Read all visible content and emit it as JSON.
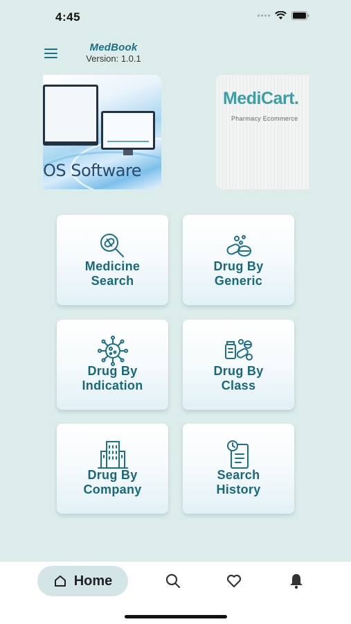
{
  "status_bar": {
    "time": "4:45"
  },
  "header": {
    "app_name": "MedBook",
    "version": "Version: 1.0.1"
  },
  "banners": [
    {
      "text": "OS Software"
    },
    {
      "title": "MediCart.",
      "subtitle": "Pharmacy Ecommerce"
    }
  ],
  "tiles": [
    {
      "label_1": "Medicine",
      "label_2": "Search",
      "icon": "medicine-search-icon"
    },
    {
      "label_1": "Drug By",
      "label_2": "Generic",
      "icon": "pills-icon"
    },
    {
      "label_1": "Drug By",
      "label_2": "Indication",
      "icon": "virus-icon"
    },
    {
      "label_1": "Drug By",
      "label_2": "Class",
      "icon": "medication-class-icon"
    },
    {
      "label_1": "Drug By",
      "label_2": "Company",
      "icon": "building-icon"
    },
    {
      "label_1": "Search",
      "label_2": "History",
      "icon": "history-clipboard-icon"
    }
  ],
  "bottom_nav": {
    "home_label": "Home",
    "items": [
      "home-icon",
      "search-icon",
      "heart-icon",
      "bell-icon"
    ]
  },
  "colors": {
    "accent": "#17697a",
    "background": "#dcecea",
    "nav_active": "#d4e5e7"
  }
}
